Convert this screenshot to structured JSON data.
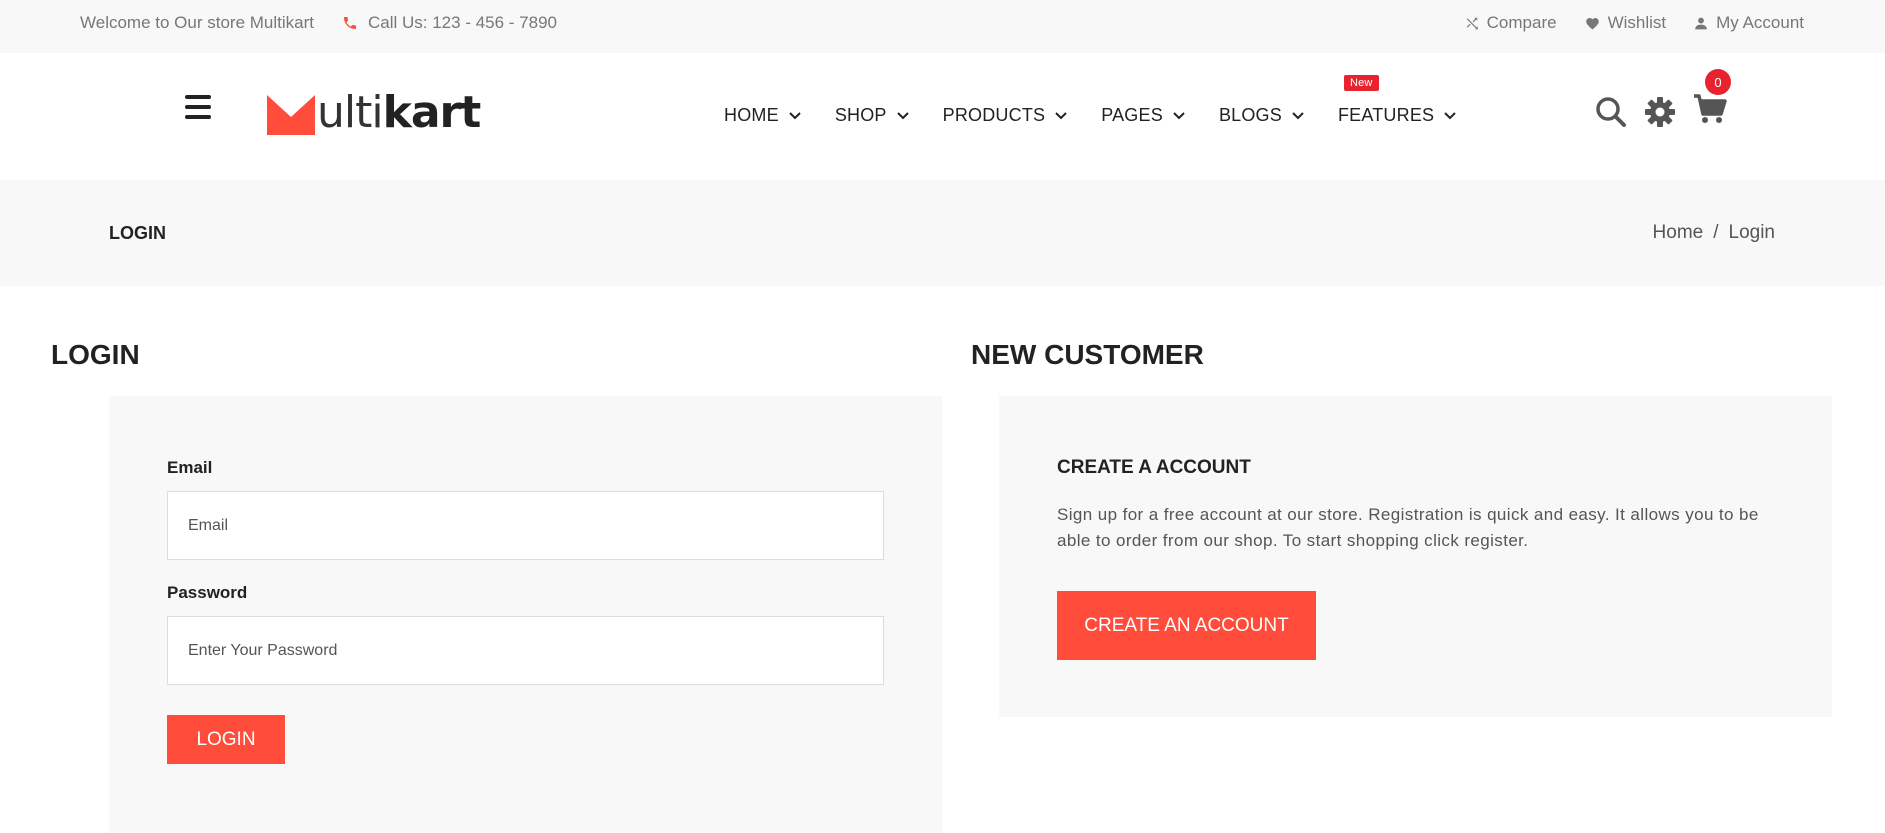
{
  "topbar": {
    "welcome": "Welcome to Our store Multikart",
    "call": "Call Us: 123 - 456 - 7890",
    "compare": "Compare",
    "wishlist": "Wishlist",
    "account": "My Account"
  },
  "header": {
    "logo_part1": "ulti",
    "logo_part2": "kart",
    "nav": [
      {
        "label": "HOME"
      },
      {
        "label": "SHOP"
      },
      {
        "label": "PRODUCTS"
      },
      {
        "label": "PAGES"
      },
      {
        "label": "BLOGS"
      },
      {
        "label": "FEATURES",
        "badge": "New"
      }
    ],
    "cart_count": "0"
  },
  "breadcrumb": {
    "page_title": "LOGIN",
    "home": "Home",
    "separator": "/",
    "current": "Login"
  },
  "login": {
    "title": "LOGIN",
    "email_label": "Email",
    "email_placeholder": "Email",
    "password_label": "Password",
    "password_placeholder": "Enter Your Password",
    "button": "LOGIN"
  },
  "new_customer": {
    "title": "NEW CUSTOMER",
    "subtitle": "CREATE A ACCOUNT",
    "description": "Sign up for a free account at our store. Registration is quick and easy. It allows you to be able to order from our shop. To start shopping click register.",
    "button": "CREATE AN ACCOUNT"
  },
  "colors": {
    "accent": "#ff4c3b",
    "badge": "#e6232f",
    "panel": "#f8f8f8"
  },
  "icons": [
    "phone-icon",
    "shuffle-icon",
    "heart-icon",
    "user-icon",
    "menu-icon",
    "chevron-down-icon",
    "search-icon",
    "gear-icon",
    "cart-icon"
  ]
}
